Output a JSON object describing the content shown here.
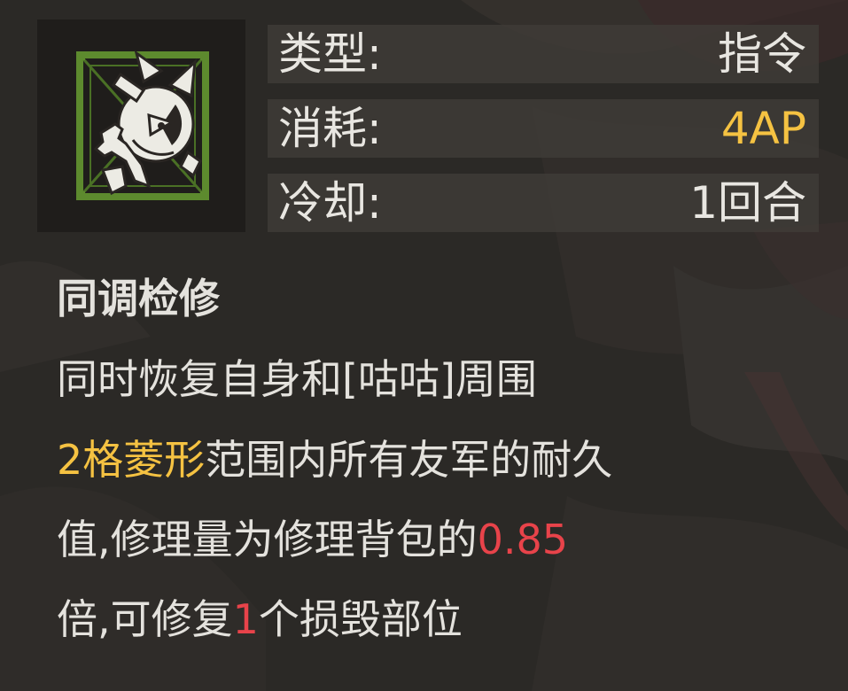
{
  "skill": {
    "icon": "robot-head-wrench-icon",
    "name": "同调检修",
    "stats": {
      "type_label": "类型:",
      "type_value": "指令",
      "cost_label": "消耗:",
      "cost_value": "4AP",
      "cooldown_label": "冷却:",
      "cooldown_value": "1回合"
    },
    "description": {
      "line1": "同时恢复自身和[咕咕]周围",
      "line2_highlight": "2格菱形",
      "line2_rest": "范围内所有友军的耐久",
      "line3_text": "值,修理量为修理背包的",
      "line3_value": "0.85",
      "line4_text": "倍,可修复",
      "line4_value": "1",
      "line4_rest": "个损毁部位"
    }
  },
  "colors": {
    "panel_background": "#2b2926",
    "stat_row": "#403c39",
    "text": "#e4e2dd",
    "accent_yellow": "#f5c242",
    "accent_red": "#e8434a",
    "icon_green": "#5d8a2e"
  }
}
